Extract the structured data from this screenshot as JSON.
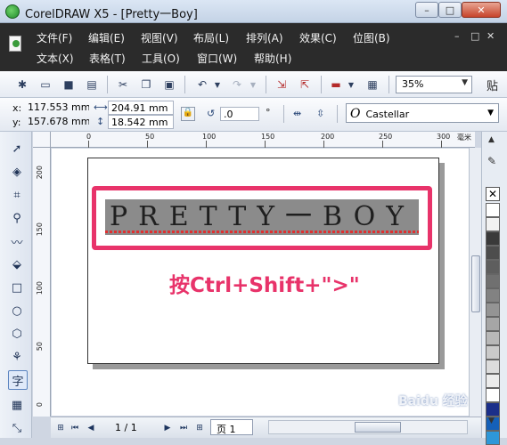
{
  "window": {
    "title": "CorelDRAW X5 - [Pretty一Boy]",
    "minimize": "–",
    "maximize": "□",
    "close": "✕"
  },
  "menu": {
    "row1": [
      "文件(F)",
      "编辑(E)",
      "视图(V)",
      "布局(L)",
      "排列(A)",
      "效果(C)",
      "位图(B)"
    ],
    "row2": [
      "文本(X)",
      "表格(T)",
      "工具(O)",
      "窗口(W)",
      "帮助(H)"
    ],
    "doc_controls": [
      "–",
      "□",
      "✕"
    ]
  },
  "toolbar": {
    "zoom": "35%",
    "paste_label": "贴"
  },
  "properties": {
    "x_label": "x:",
    "x_value": "117.553 mm",
    "y_label": "y:",
    "y_value": "157.678 mm",
    "width": "204.91 mm",
    "height": "18.542 mm",
    "rotation": ".0",
    "degree": "°",
    "font": "Castellar",
    "font_icon": "O"
  },
  "ruler": {
    "top_labels": [
      "0",
      "50",
      "100",
      "150",
      "200",
      "250",
      "300"
    ],
    "left_labels": [
      "200",
      "150",
      "100",
      "50",
      "0"
    ],
    "unit": "毫米"
  },
  "canvas": {
    "text": "PRETTY一BOY",
    "annotation": "按Ctrl+Shift+\">\""
  },
  "statusbar": {
    "page_count": "1 / 1",
    "page_tab": "页 1"
  },
  "palette": {
    "colors": [
      "#ffffff",
      "#f2f2f2",
      "#3a3a3a",
      "#4d4d4d",
      "#5e5e5e",
      "#707070",
      "#828282",
      "#949494",
      "#a6a6a6",
      "#b8b8b8",
      "#cacaca",
      "#dcdcdc",
      "#ececec",
      "#ffffff",
      "#1b2f8a",
      "#1560b8",
      "#2e97d8"
    ]
  },
  "watermark": "Baidu 经验"
}
